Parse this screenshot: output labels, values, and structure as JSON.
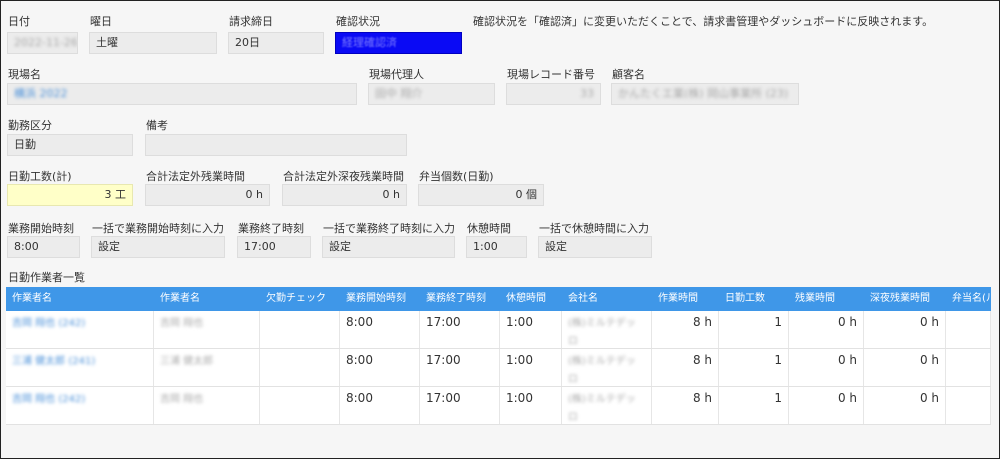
{
  "header": {
    "date": {
      "label": "日付",
      "value": "2022-11-26"
    },
    "weekday": {
      "label": "曜日",
      "value": "土曜"
    },
    "closing_day": {
      "label": "請求締日",
      "value": "20日"
    },
    "confirm_status": {
      "label": "確認状況",
      "value": "経理確認済"
    },
    "confirm_note": "確認状況を「確認済」に変更いただくことで、請求書管理やダッシュボードに反映されます。"
  },
  "site": {
    "site_name": {
      "label": "現場名",
      "value": "横浜 2022"
    },
    "site_agent": {
      "label": "現場代理人",
      "value": "田中 翔介"
    },
    "site_record_no": {
      "label": "現場レコード番号",
      "value": "33"
    },
    "customer": {
      "label": "顧客名",
      "value": "かんたくエ業(株) 岡山事業所 (23)"
    }
  },
  "work": {
    "work_type": {
      "label": "勤務区分",
      "value": "日勤"
    },
    "remarks": {
      "label": "備考",
      "value": ""
    }
  },
  "totals": {
    "day_man_days": {
      "label": "日勤工数(計)",
      "value": "3 工"
    },
    "overtime_hours": {
      "label": "合計法定外残業時間",
      "value": "0 h"
    },
    "night_overtime_hours": {
      "label": "合計法定外深夜残業時間",
      "value": "0 h"
    },
    "lunch_count": {
      "label": "弁当個数(日勤)",
      "value": "0 個"
    }
  },
  "times": {
    "start_time": {
      "label": "業務開始時刻",
      "value": "8:00"
    },
    "bulk_start": {
      "label": "一括で業務開始時刻に入力",
      "value": "設定"
    },
    "end_time": {
      "label": "業務終了時刻",
      "value": "17:00"
    },
    "bulk_end": {
      "label": "一括で業務終了時刻に入力",
      "value": "設定"
    },
    "break_time": {
      "label": "休憩時間",
      "value": "1:00"
    },
    "bulk_break": {
      "label": "一括で休憩時間に入力",
      "value": "設定"
    }
  },
  "workers": {
    "title": "日勤作業者一覧",
    "columns": [
      "作業者名",
      "作業者名",
      "欠勤チェック",
      "業務開始時刻",
      "業務終了時刻",
      "休憩時間",
      "会社名",
      "作業時間",
      "日勤工数",
      "残業時間",
      "深夜残業時間",
      "弁当名(ル)"
    ],
    "rows": [
      {
        "name_link": "吉岡 翔也 (242)",
        "name": "吉岡 翔也",
        "absent": "",
        "start": "8:00",
        "end": "17:00",
        "break": "1:00",
        "company": "(株)ミルテデッ ロ",
        "work_hours": "8 h",
        "man_days": "1",
        "overtime": "0 h",
        "night_overtime": "0 h",
        "lunch": ""
      },
      {
        "name_link": "三浦 健太郎 (241)",
        "name": "三浦 健太郎",
        "absent": "",
        "start": "8:00",
        "end": "17:00",
        "break": "1:00",
        "company": "(株)ミルテデッ ロ",
        "work_hours": "8 h",
        "man_days": "1",
        "overtime": "0 h",
        "night_overtime": "0 h",
        "lunch": ""
      },
      {
        "name_link": "吉岡 翔也 (242)",
        "name": "吉岡 翔也",
        "absent": "",
        "start": "8:00",
        "end": "17:00",
        "break": "1:00",
        "company": "(株)ミルテデッ ロ",
        "work_hours": "8 h",
        "man_days": "1",
        "overtime": "0 h",
        "night_overtime": "0 h",
        "lunch": ""
      }
    ]
  },
  "colors": {
    "header_blue": "#3f97e8",
    "status_blue": "#0a0af5",
    "highlight_yellow": "#ffffc8"
  }
}
